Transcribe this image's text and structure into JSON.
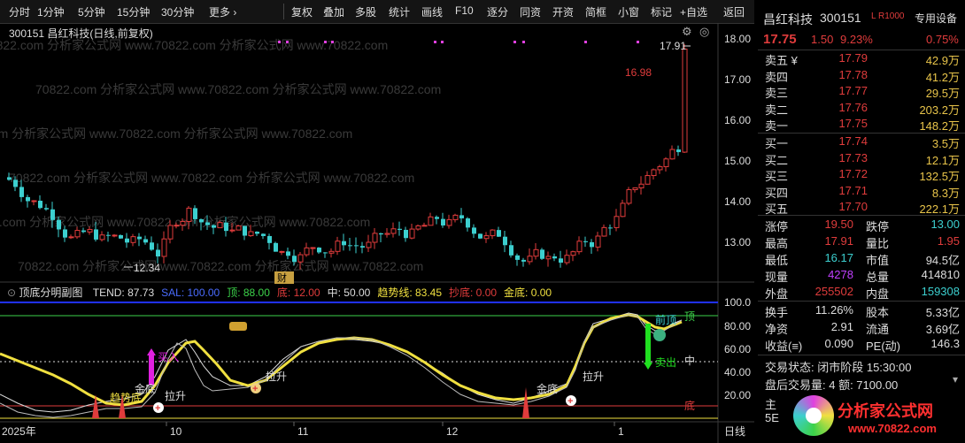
{
  "toolbar": {
    "periods": [
      "分时",
      "1分钟",
      "5分钟",
      "15分钟",
      "30分钟",
      "更多 ›"
    ],
    "buttons": [
      "复权",
      "叠加",
      "多股",
      "统计",
      "画线",
      "F10",
      "逐分",
      "同资",
      "开资",
      "简框",
      "小窗",
      "标记",
      "+自选",
      "返回"
    ]
  },
  "main_chart": {
    "title": "300151 昌红科技(日线,前复权)",
    "high_label": "17.91",
    "mid_label": "16.98",
    "low_label": "12.34",
    "badge": "财",
    "price_ticks": [
      "18.00",
      "17.00",
      "16.00",
      "15.00",
      "14.00",
      "13.00"
    ]
  },
  "sub_chart": {
    "name": "顶底分明副图",
    "indicators": [
      {
        "text": "TEND: 87.73",
        "color": "#dddddd"
      },
      {
        "text": "SAL: 100.00",
        "color": "#4a6cff"
      },
      {
        "text": "顶: 88.00",
        "color": "#3cd24a"
      },
      {
        "text": "底: 12.00",
        "color": "#e03c3c"
      },
      {
        "text": "中: 50.00",
        "color": "#dddddd"
      },
      {
        "text": "趋势线: 83.45",
        "color": "#f0e040"
      },
      {
        "text": "抄底: 0.00",
        "color": "#e03c3c"
      },
      {
        "text": "金底: 0.00",
        "color": "#f0e040"
      }
    ],
    "labels": {
      "buy": "买入",
      "sell": "卖出",
      "top": "顶",
      "mid": "中",
      "bottom": "底",
      "gold_bottom": "金底",
      "lift": "拉升",
      "trend_bottom": "趋势底",
      "top_confirm": "前顶",
      "chao_di": "抄底"
    },
    "ticks": [
      "100.0",
      "80.00",
      "60.00",
      "40.00",
      "20.00"
    ]
  },
  "x_axis": {
    "labels": [
      "2025年",
      "10",
      "11",
      "12",
      "1"
    ],
    "period": "日线"
  },
  "quote": {
    "name": "昌红科技",
    "code": "300151",
    "tag": "L R1000",
    "special": "专用设备",
    "price": "17.75",
    "change": "1.50",
    "pct": "9.23%",
    "ratio": "0.75%",
    "asks": [
      {
        "label": "卖五 ¥",
        "price": "17.79",
        "vol": "42.9万"
      },
      {
        "label": "卖四",
        "price": "17.78",
        "vol": "41.2万"
      },
      {
        "label": "卖三",
        "price": "17.77",
        "vol": "29.5万"
      },
      {
        "label": "卖二",
        "price": "17.76",
        "vol": "203.2万"
      },
      {
        "label": "卖一",
        "price": "17.75",
        "vol": "148.2万"
      }
    ],
    "bids": [
      {
        "label": "买一",
        "price": "17.74",
        "vol": "3.5万"
      },
      {
        "label": "买二",
        "price": "17.73",
        "vol": "12.1万"
      },
      {
        "label": "买三",
        "price": "17.72",
        "vol": "132.5万"
      },
      {
        "label": "买四",
        "price": "17.71",
        "vol": "8.3万"
      },
      {
        "label": "买五",
        "price": "17.70",
        "vol": "222.1万"
      }
    ],
    "stats": [
      {
        "k1": "涨停",
        "v1": "19.50",
        "c1": "#e03c3c",
        "k2": "跌停",
        "v2": "13.00",
        "c2": "#3ccfcf"
      },
      {
        "k1": "最高",
        "v1": "17.91",
        "c1": "#e03c3c",
        "k2": "量比",
        "v2": "1.95",
        "c2": "#e03c3c"
      },
      {
        "k1": "最低",
        "v1": "16.17",
        "c1": "#3ccfcf",
        "k2": "市值",
        "v2": "94.5亿",
        "c2": "#dddddd"
      },
      {
        "k1": "现量",
        "v1": "4278",
        "c1": "#c040ff",
        "k2": "总量",
        "v2": "414810",
        "c2": "#dddddd"
      },
      {
        "k1": "外盘",
        "v1": "255502",
        "c1": "#e03c3c",
        "k2": "内盘",
        "v2": "159308",
        "c2": "#3ccfcf"
      }
    ],
    "stats2": [
      {
        "k1": "换手",
        "v1": "11.26%",
        "k2": "股本",
        "v2": "5.33亿"
      },
      {
        "k1": "净资",
        "v1": "2.91",
        "k2": "流通",
        "v2": "3.69亿"
      },
      {
        "k1": "收益(≡)",
        "v1": "0.090",
        "k2": "PE(动)",
        "v2": "146.3"
      }
    ],
    "status": "交易状态: 闭市阶段 15:30:00",
    "after_hours": "盘后交易量: 4  额: 7100.00",
    "extra1": "主",
    "extra2": "5E"
  },
  "logo": {
    "text": "分析家公式网",
    "url": "www.70822.com"
  },
  "watermark_text": "70822.com 分析家公式网 www.70822.com 分析家公式网 www.70822.com"
}
